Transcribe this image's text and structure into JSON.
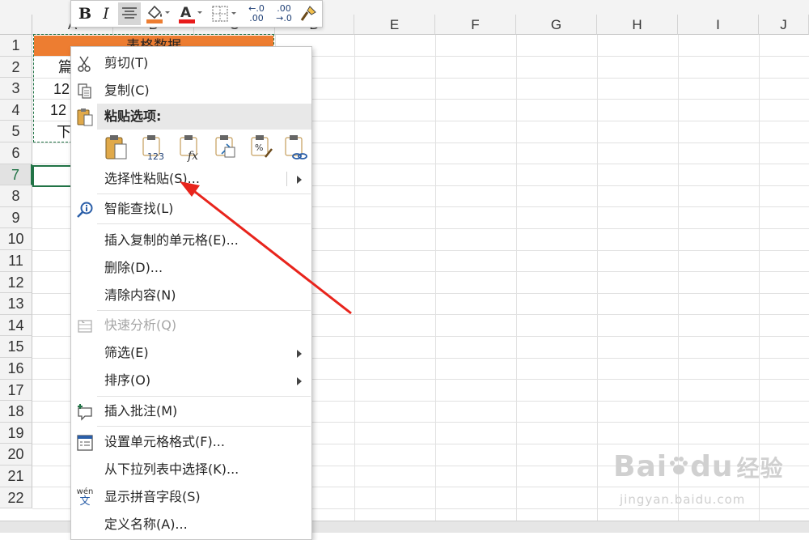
{
  "columns": [
    "A",
    "B",
    "C",
    "D",
    "E",
    "F",
    "G",
    "H",
    "I",
    "J"
  ],
  "rows": [
    "1",
    "2",
    "3",
    "4",
    "5",
    "6",
    "7",
    "8",
    "9",
    "10",
    "11",
    "12",
    "13",
    "14",
    "15",
    "16",
    "17",
    "18",
    "19",
    "20",
    "21",
    "22"
  ],
  "cells": {
    "title": "表格数据",
    "a2": "篇",
    "a3": "12",
    "a4": "12",
    "a5": "下"
  },
  "toolbar": {
    "bold": "B",
    "italic": "I",
    "inc_decimal_top": "←.0",
    "inc_decimal_bottom": ".00",
    "dec_decimal_top": ".00",
    "dec_decimal_bottom": "→.0"
  },
  "menu": {
    "cut": "剪切(T)",
    "copy": "复制(C)",
    "paste_options": "粘贴选项:",
    "paste_values_badge": "123",
    "paste_formula_badge": "fx",
    "paste_percent_badge": "%",
    "paste_special": "选择性粘贴(S)...",
    "smart_lookup": "智能查找(L)",
    "insert_copied": "插入复制的单元格(E)...",
    "delete": "删除(D)...",
    "clear": "清除内容(N)",
    "quick_analysis": "快速分析(Q)",
    "filter": "筛选(E)",
    "sort": "排序(O)",
    "insert_comment": "插入批注(M)",
    "format_cells": "设置单元格格式(F)...",
    "pick_from_list": "从下拉列表中选择(K)...",
    "show_phonetic": "显示拼音字段(S)",
    "phonetic_icon_top": "wén",
    "phonetic_icon_bottom": "文",
    "define_name": "定义名称(A)..."
  },
  "watermark": {
    "brand": "Bai",
    "brand2": "du",
    "suffix": "经验",
    "url": "jingyan.baidu.com"
  },
  "colors": {
    "accent": "#217346",
    "header_fill": "#ed7d31",
    "annotation_arrow": "#e8241c"
  }
}
